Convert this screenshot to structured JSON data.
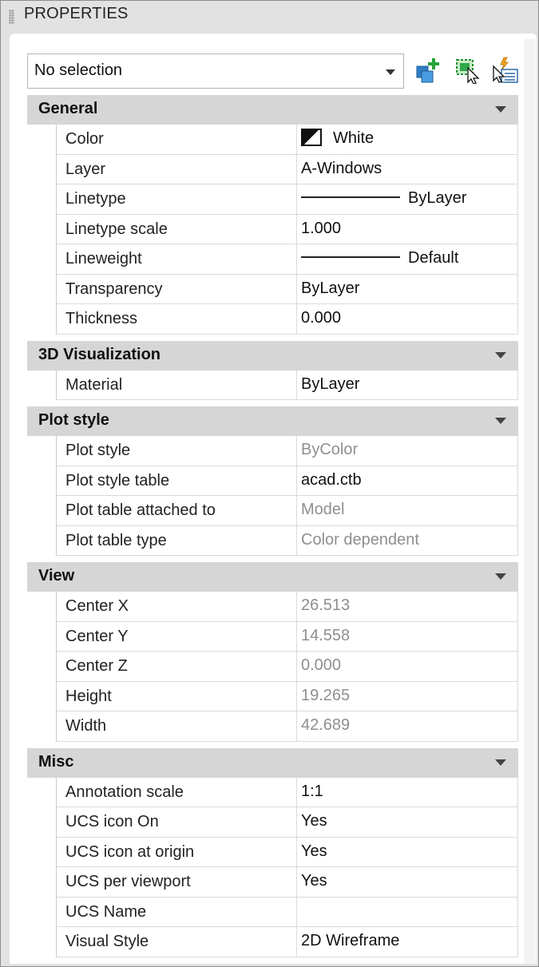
{
  "panel": {
    "title": "PROPERTIES"
  },
  "selection": {
    "value": "No selection"
  },
  "toolbar": {
    "toggle_pickadd_icon": "toggle-pickadd-icon",
    "select_objects_icon": "select-objects-icon",
    "quick_select_icon": "quick-select-icon"
  },
  "colors": {
    "category_bg": "#d6d6d6",
    "dim_text": "#8f8f8f",
    "panel_bg": "#e2e2e2"
  },
  "categories": {
    "general": {
      "title": "General",
      "rows": [
        {
          "label": "Color",
          "value": "White"
        },
        {
          "label": "Layer",
          "value": "A-Windows"
        },
        {
          "label": "Linetype",
          "value": "ByLayer"
        },
        {
          "label": "Linetype scale",
          "value": "1.000"
        },
        {
          "label": "Lineweight",
          "value": "Default"
        },
        {
          "label": "Transparency",
          "value": "ByLayer"
        },
        {
          "label": "Thickness",
          "value": "0.000"
        }
      ]
    },
    "visualization": {
      "title": "3D Visualization",
      "rows": [
        {
          "label": "Material",
          "value": "ByLayer"
        }
      ]
    },
    "plot": {
      "title": "Plot style",
      "rows": [
        {
          "label": "Plot style",
          "value": "ByColor"
        },
        {
          "label": "Plot style table",
          "value": "acad.ctb"
        },
        {
          "label": "Plot table attached to",
          "value": "Model"
        },
        {
          "label": "Plot table type",
          "value": "Color dependent"
        }
      ]
    },
    "view": {
      "title": "View",
      "rows": [
        {
          "label": "Center X",
          "value": "26.513"
        },
        {
          "label": "Center Y",
          "value": "14.558"
        },
        {
          "label": "Center Z",
          "value": "0.000"
        },
        {
          "label": "Height",
          "value": "19.265"
        },
        {
          "label": "Width",
          "value": "42.689"
        }
      ]
    },
    "misc": {
      "title": "Misc",
      "rows": [
        {
          "label": "Annotation scale",
          "value": "1:1"
        },
        {
          "label": "UCS icon On",
          "value": "Yes"
        },
        {
          "label": "UCS icon at origin",
          "value": "Yes"
        },
        {
          "label": "UCS per viewport",
          "value": "Yes"
        },
        {
          "label": "UCS Name",
          "value": ""
        },
        {
          "label": "Visual Style",
          "value": "2D Wireframe"
        }
      ]
    }
  }
}
